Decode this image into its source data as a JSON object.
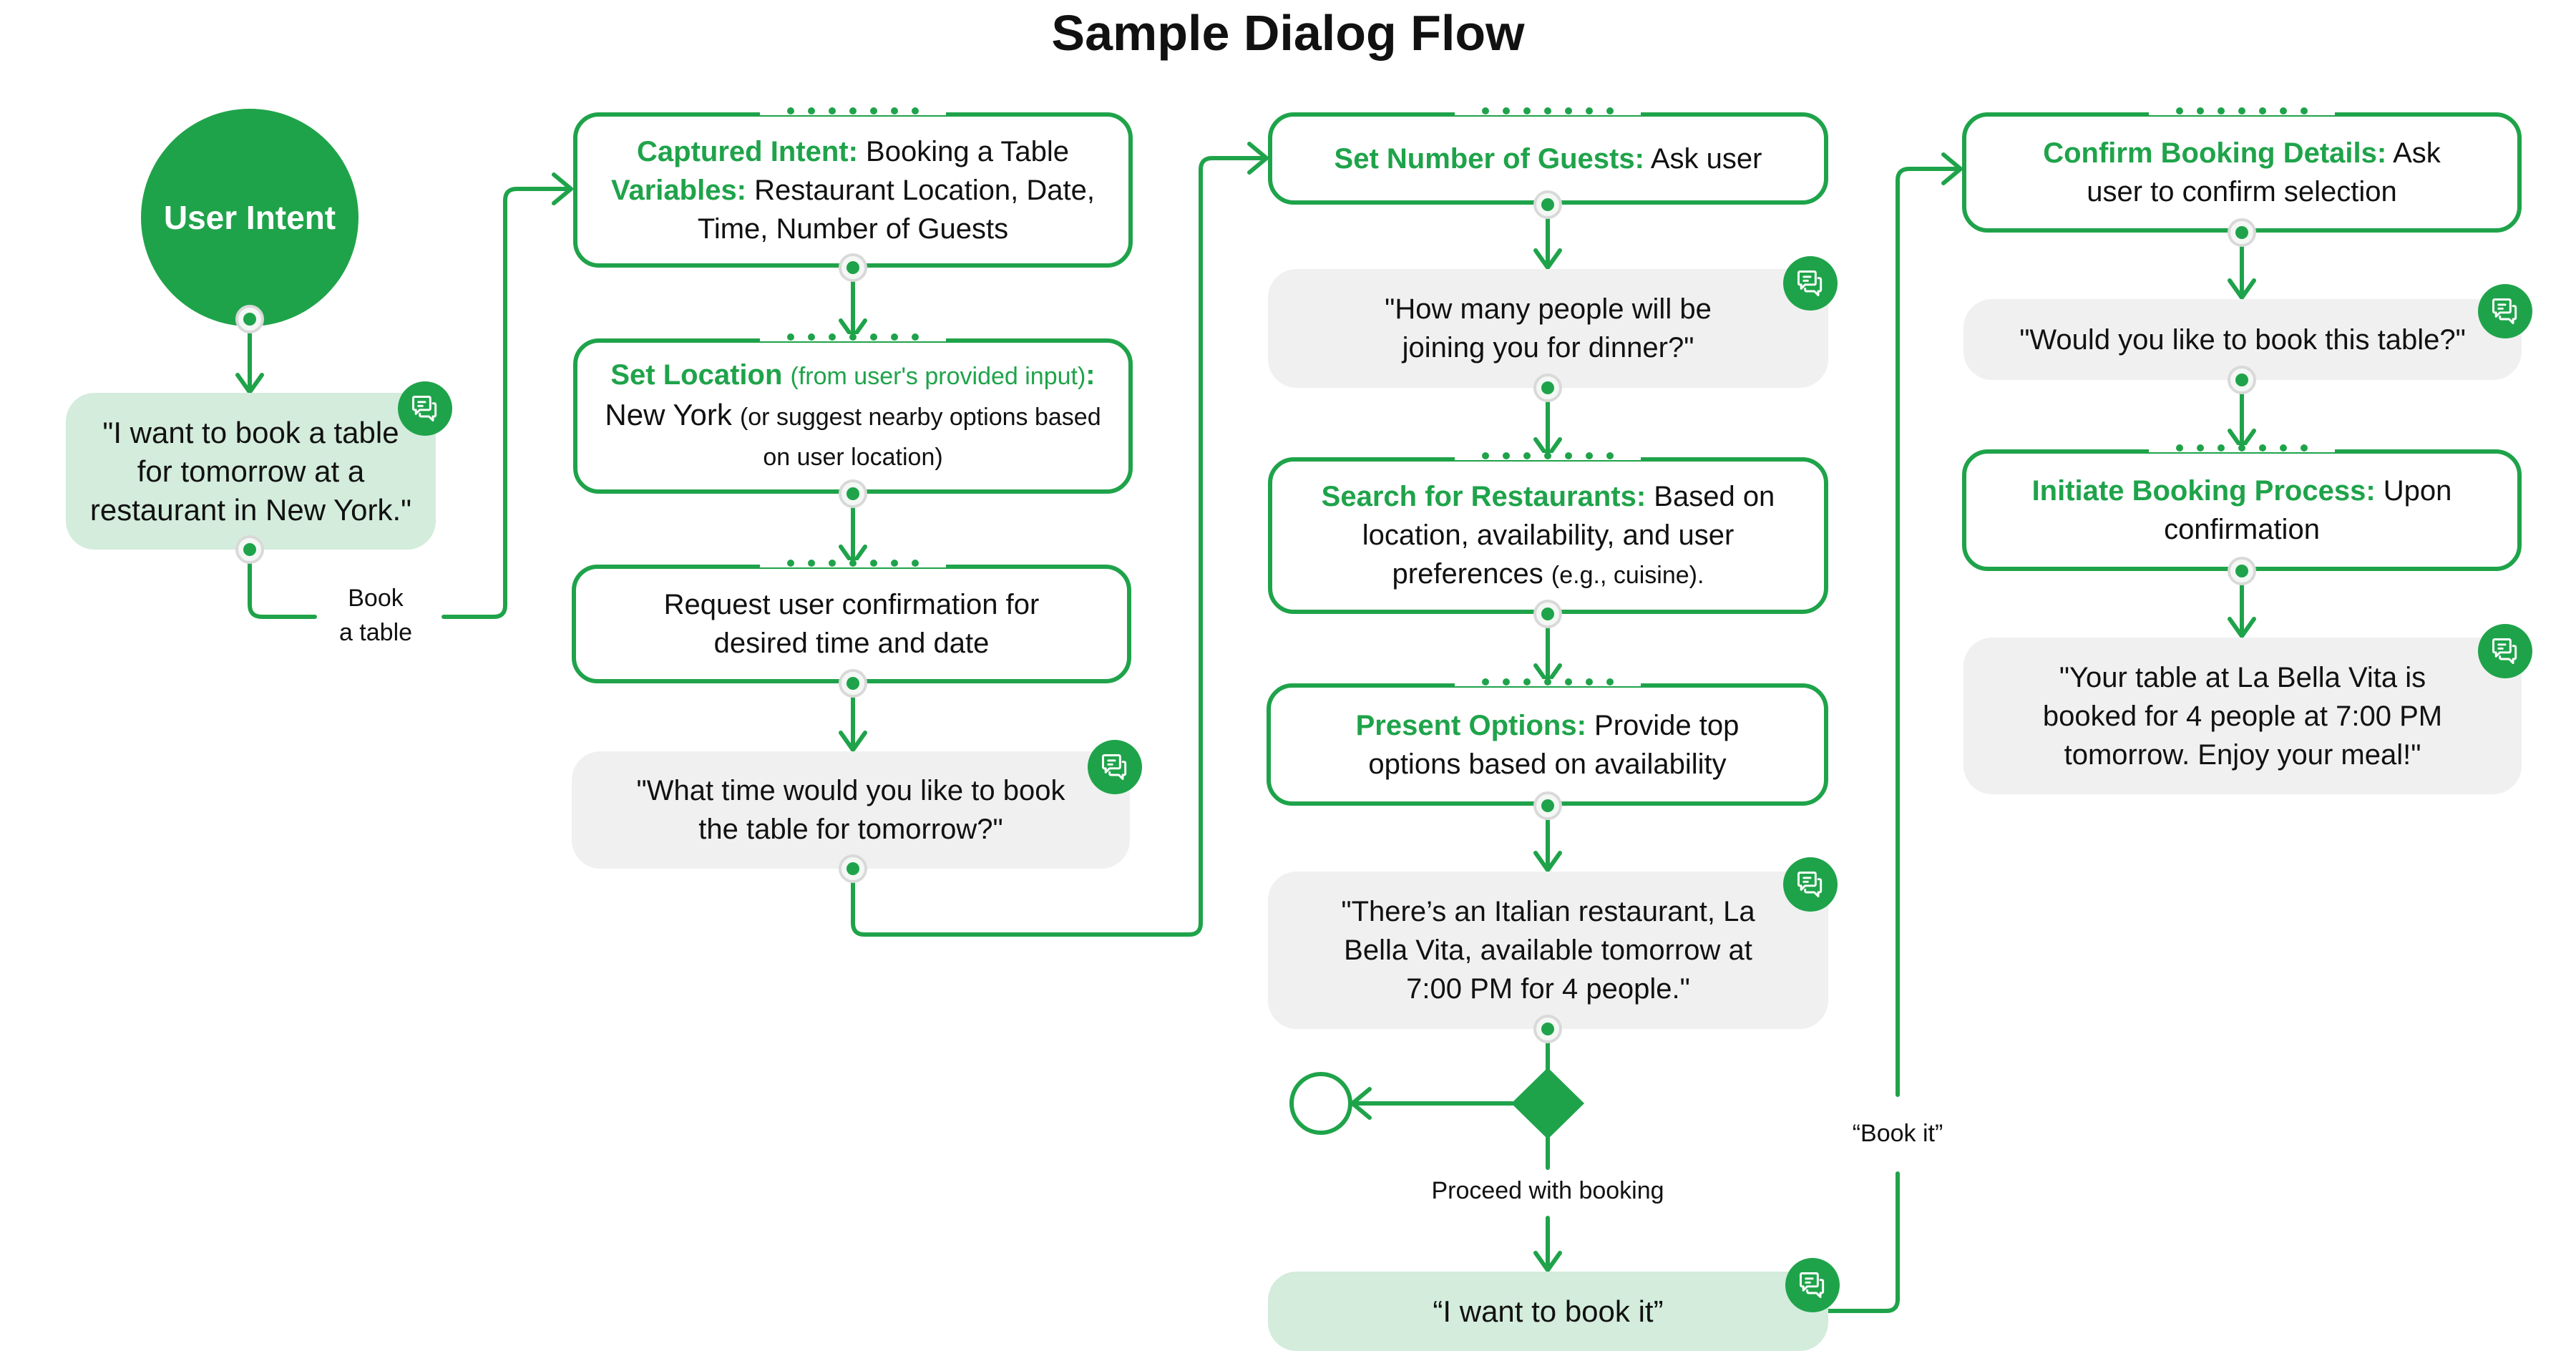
{
  "title": "Sample Dialog Flow",
  "colors": {
    "accent": "#1fa34a",
    "user_bubble": "#d3ecdc",
    "bot_bubble": "#f0f0f0",
    "connector_ring": "#d9d9d9"
  },
  "start": {
    "label": "User Intent"
  },
  "user_utterance_1": {
    "text": "\"I want to book a table for tomorrow at a restaurant in New York.\"",
    "icon": "chat-icon"
  },
  "edge_labels": {
    "book_a_table_1": "Book",
    "book_a_table_2": "a table",
    "proceed": "Proceed with booking",
    "book_it": "“Book it”"
  },
  "col2": {
    "captured": {
      "k1": "Captured Intent:",
      "v1": "Booking a Table",
      "k2": "Variables:",
      "v2": "Restaurant Location, Date, Time, Number of Guests"
    },
    "location": {
      "k": "Set Location",
      "k_note": "(from user's provided input)",
      "colon": ":",
      "v": "New York",
      "v_note": "(or suggest nearby options based on user location)"
    },
    "request": {
      "text": "Request user confirmation for desired time and date"
    },
    "ask_time": {
      "text": "\"What time would you like to book the table for tomorrow?\"",
      "icon": "chat-icon"
    }
  },
  "col3": {
    "guests": {
      "k": "Set Number of Guests:",
      "v": "Ask user"
    },
    "ask_guests": {
      "text": "\"How many people will be joining you for dinner?\"",
      "icon": "chat-icon"
    },
    "search": {
      "k": "Search for Restaurants:",
      "v": "Based on location, availability, and user preferences",
      "note": "(e.g., cuisine)."
    },
    "present": {
      "k": "Present Options:",
      "v": "Provide top options based on availability"
    },
    "offer": {
      "text": "\"There’s an Italian restaurant, La Bella Vita, available tomorrow at 7:00 PM for 4 people.\"",
      "icon": "chat-icon"
    },
    "user_book": {
      "text": "“I want to book it”",
      "icon": "chat-icon"
    }
  },
  "col4": {
    "confirm": {
      "k": "Confirm Booking Details:",
      "v": "Ask user to confirm selection"
    },
    "ask_confirm": {
      "text": "\"Would you like to book this table?\"",
      "icon": "chat-icon"
    },
    "initiate": {
      "k": "Initiate Booking Process:",
      "v": "Upon confirmation"
    },
    "booked": {
      "text": "\"Your table at La Bella Vita is booked for 4 people at 7:00 PM tomorrow. Enjoy your meal!\"",
      "icon": "chat-icon"
    }
  }
}
